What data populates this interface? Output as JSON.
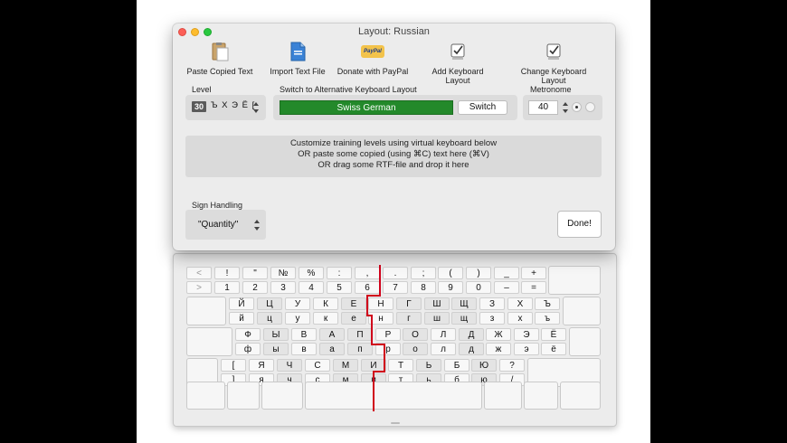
{
  "window": {
    "title": "Layout: Russian"
  },
  "toolbar": {
    "items": [
      {
        "label": "Paste Copied Text",
        "icon": "paste-icon"
      },
      {
        "label": "Import Text File",
        "icon": "file-icon"
      },
      {
        "label": "Donate with PayPal",
        "icon": "paypal-icon",
        "icon_text": "PayPal"
      },
      {
        "label": "Add Keyboard Layout",
        "icon": "checkbox-add-icon"
      },
      {
        "label": "Change Keyboard Layout",
        "icon": "checkbox-change-icon"
      }
    ]
  },
  "level": {
    "label": "Level",
    "number": "30",
    "chars": "Ъ Х Э Ё ["
  },
  "switch_layout": {
    "label": "Switch to Alternative Keyboard Layout",
    "value": "Swiss German",
    "button": "Switch"
  },
  "metronome": {
    "label": "Metronome",
    "value": "40"
  },
  "instructions": {
    "line1": "Customize training levels using virtual keyboard below",
    "line2": "OR paste some copied (using ⌘C) text here (⌘V)",
    "line3": "OR drag some RTF-file and drop it here"
  },
  "sign_handling": {
    "label": "Sign Handling",
    "value": "\"Quantity\""
  },
  "done_button": "Done!",
  "keyboard": {
    "number_row": {
      "top": [
        "<",
        "!",
        "\"",
        "№",
        "%",
        ":",
        ",",
        ".",
        ";",
        "(",
        ")",
        "_",
        "+"
      ],
      "bottom": [
        ">",
        "1",
        "2",
        "3",
        "4",
        "5",
        "6",
        "7",
        "8",
        "9",
        "0",
        "–",
        "="
      ]
    },
    "row1": {
      "top": [
        "Й",
        "Ц",
        "У",
        "К",
        "Е",
        "Н",
        "Г",
        "Ш",
        "Щ",
        "З",
        "Х",
        "Ъ"
      ],
      "bottom": [
        "й",
        "ц",
        "у",
        "к",
        "е",
        "н",
        "г",
        "ш",
        "щ",
        "з",
        "х",
        "ъ"
      ]
    },
    "row2": {
      "top": [
        "Ф",
        "Ы",
        "В",
        "А",
        "П",
        "Р",
        "О",
        "Л",
        "Д",
        "Ж",
        "Э",
        "Ё"
      ],
      "bottom": [
        "ф",
        "ы",
        "в",
        "а",
        "п",
        "р",
        "о",
        "л",
        "д",
        "ж",
        "э",
        "ё"
      ]
    },
    "row3": {
      "top": [
        "[",
        "Я",
        "Ч",
        "С",
        "М",
        "И",
        "Т",
        "Ь",
        "Б",
        "Ю",
        "?"
      ],
      "bottom": [
        "]",
        "я",
        "ч",
        "с",
        "м",
        "и",
        "т",
        "ь",
        "б",
        "ю",
        "/"
      ]
    }
  },
  "colors": {
    "green": "#23892a",
    "red_line": "#d0021b"
  }
}
